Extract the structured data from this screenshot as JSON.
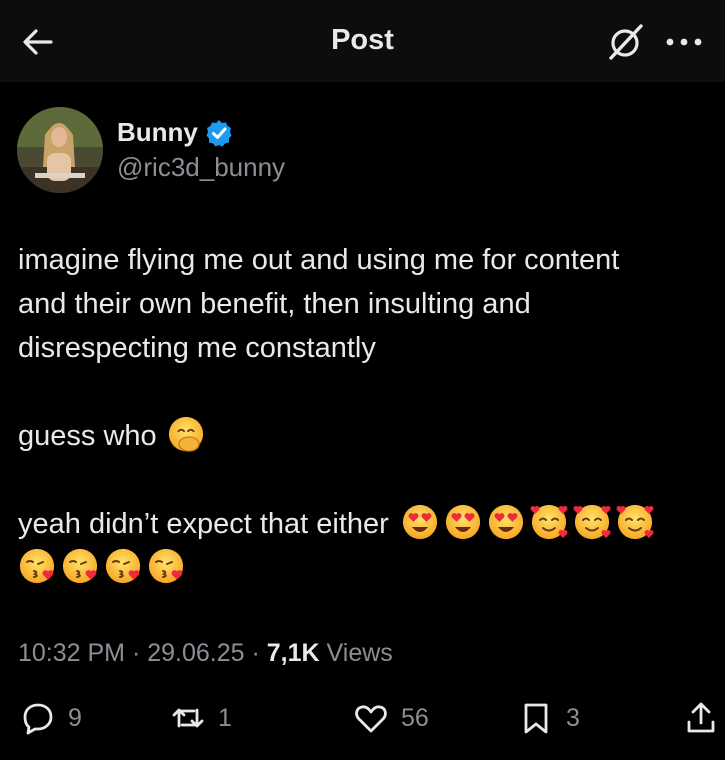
{
  "header": {
    "title": "Post",
    "back_icon": "arrow-left-icon",
    "grok_icon": "grok-icon",
    "more_icon": "more-icon"
  },
  "author": {
    "name": "Bunny",
    "handle": "@ric3d_bunny",
    "verified": true,
    "verified_color": "#1d9bf0"
  },
  "post": {
    "lines": [
      "imagine flying me out and using me for content",
      "and their own benefit, then insulting and",
      "disrespecting me constantly",
      "guess who",
      "yeah didn’t expect that either"
    ],
    "emojis": {
      "guess_who": "hand-over-mouth-emoji",
      "line5": [
        "heart-eyes-emoji",
        "heart-eyes-emoji",
        "heart-eyes-emoji",
        "smiling-hearts-emoji",
        "smiling-hearts-emoji",
        "smiling-hearts-emoji"
      ],
      "line6": [
        "kissing-heart-emoji",
        "kissing-heart-emoji",
        "kissing-heart-emoji",
        "kissing-heart-emoji"
      ]
    }
  },
  "meta": {
    "time": "10:32 PM",
    "sep1": " · ",
    "date": "29.06.25",
    "sep2": " · ",
    "views_count": "7,1K",
    "views_label": " Views"
  },
  "actions": {
    "replies": "9",
    "reposts": "1",
    "likes": "56",
    "bookmarks": "3"
  },
  "colors": {
    "background": "#000000",
    "header": "#0d0d0d",
    "text": "#e7e9ea",
    "muted": "#8b8f94"
  }
}
